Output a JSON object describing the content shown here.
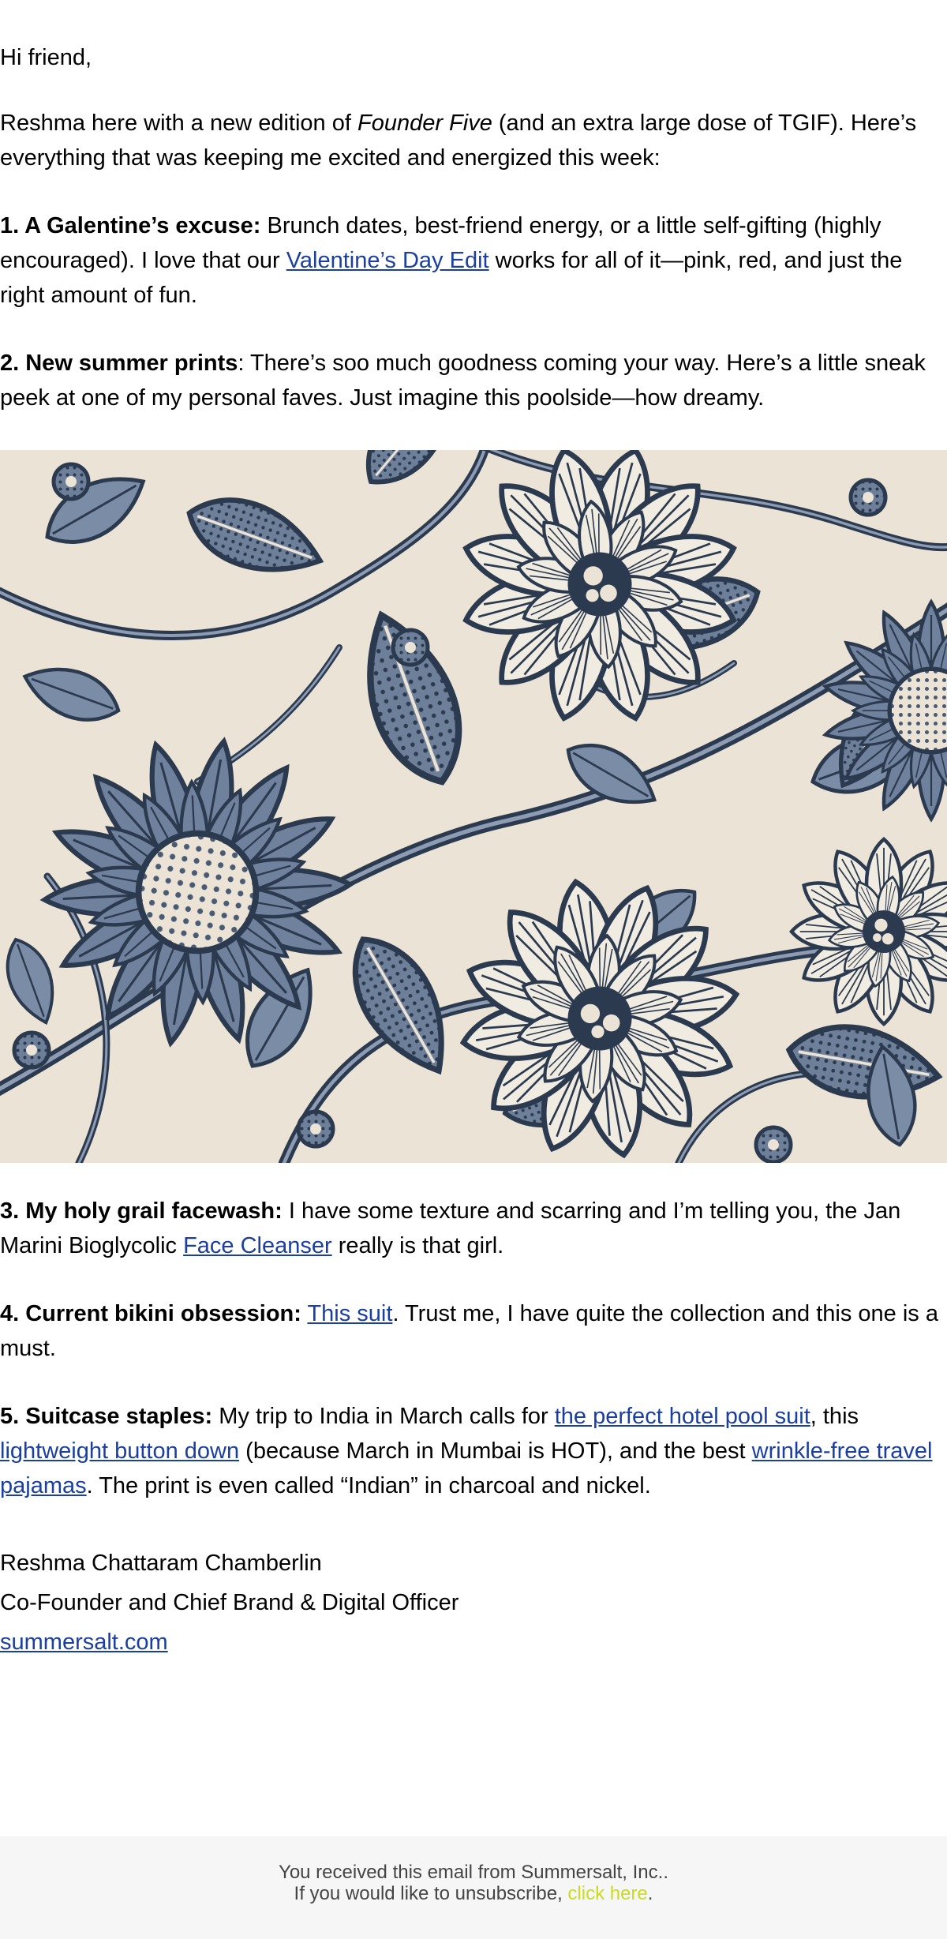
{
  "email": {
    "greeting": "Hi friend,",
    "intro": {
      "before": "Reshma here with a new edition of ",
      "italic": "Founder Five",
      "after": " (and an extra large dose of TGIF). Here’s everything that was keeping me excited and energized this week:"
    },
    "item1": {
      "heading": "1. A Galentine’s excuse:",
      "text_a": " Brunch dates, best-friend energy, or a little self-gifting (highly encouraged). I love that our ",
      "link": "Valentine’s Day Edit",
      "text_b": " works for all of it—pink, red, and just the right amount of fun."
    },
    "item2": {
      "heading": "2. New summer prints",
      "text": ": There’s soo much goodness coming your way. Here’s a little sneak peek at one of my personal faves. Just imagine this poolside—how dreamy."
    },
    "item3": {
      "heading": "3. My holy grail facewash:",
      "text_a": " I have some texture and scarring and I’m telling you, the Jan Marini Bioglycolic ",
      "link": "Face Cleanser",
      "text_b": " really is that girl."
    },
    "item4": {
      "heading": "4. Current bikini obsession:",
      "link": "This suit",
      "text": ". Trust me, I have quite the collection and this one is a must."
    },
    "item5": {
      "heading": "5. Suitcase staples:",
      "text_a": " My trip to India in March calls for ",
      "link1": "the perfect hotel pool suit",
      "text_b": ", this ",
      "link2": "lightweight button down",
      "text_c": " (because March in Mumbai is HOT), and the best ",
      "link3": "wrinkle-free travel pajamas",
      "text_d": ". The print is even called “Indian” in charcoal and nickel."
    },
    "signature": {
      "name": "Reshma Chattaram Chamberlin",
      "title": "Co-Founder and Chief Brand & Digital Officer",
      "website": "summersalt.com"
    }
  },
  "footer": {
    "line1": "You received this email from Summersalt, Inc..",
    "line2_before": "If you would like to unsubscribe, ",
    "unsubscribe_link": "click here",
    "line2_after": "."
  },
  "colors": {
    "link": "#1a3fa0",
    "footer_link": "#c9dc1e",
    "footer_bg": "#f6f6f6",
    "print_navy": "#2c3a4f",
    "print_slate": "#6d7f99",
    "print_cream": "#ebe4d6"
  }
}
